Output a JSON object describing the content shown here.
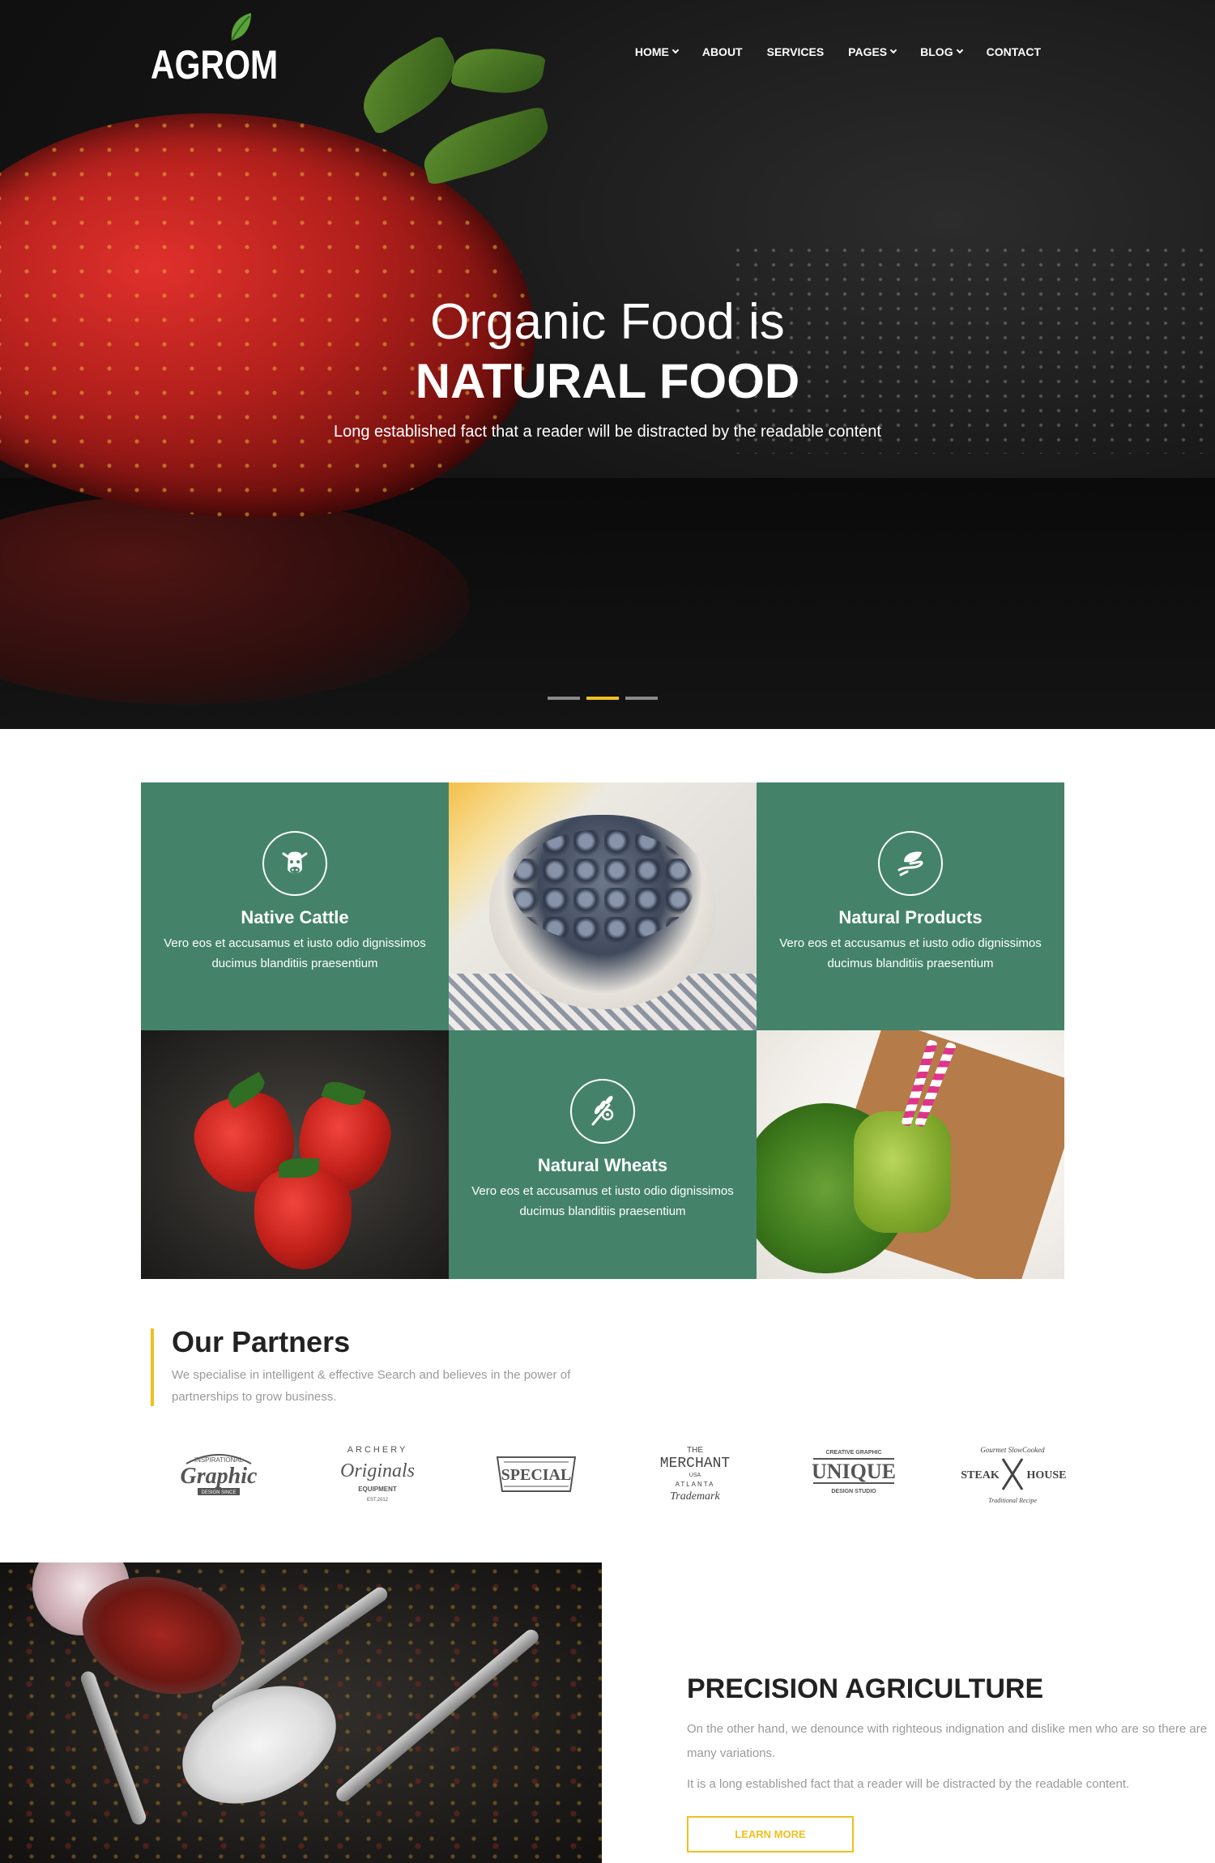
{
  "brand": {
    "logo_text": "AGROM",
    "accent": "#f0c020",
    "green": "#44836a"
  },
  "nav": {
    "items": [
      {
        "label": "HOME",
        "dropdown": true
      },
      {
        "label": "ABOUT",
        "dropdown": false
      },
      {
        "label": "SERVICES",
        "dropdown": false
      },
      {
        "label": "PAGES",
        "dropdown": true
      },
      {
        "label": "BLOG",
        "dropdown": true
      },
      {
        "label": "CONTACT",
        "dropdown": false
      }
    ]
  },
  "hero": {
    "title_line1": "Organic Food is",
    "title_line2": "NATURAL FOOD",
    "subtitle": "Long established fact that a reader will be distracted by the readable content",
    "slides": 3,
    "active_slide": 2
  },
  "features": [
    {
      "icon": "cow-icon",
      "title": "Native Cattle",
      "text": "Vero eos et accusamus et iusto odio dignissimos ducimus blanditiis praesentium"
    },
    {
      "icon": "leaf-hand-icon",
      "title": "Natural Products",
      "text": "Vero eos et accusamus et iusto odio dignissimos ducimus blanditiis praesentium"
    },
    {
      "icon": "wheat-icon",
      "title": "Natural Wheats",
      "text": "Vero eos et accusamus et iusto odio dignissimos ducimus blanditiis praesentium"
    }
  ],
  "partners": {
    "title_light": "Our",
    "title_bold": "Partners",
    "text": "We specialise in intelligent & effective Search and believes in the power of partnerships to grow business.",
    "logos": [
      {
        "name": "graphic-logo",
        "line1": "INSPIRATIONAL",
        "line2": "Graphic",
        "line3": "DESIGN SINCE"
      },
      {
        "name": "archery-logo",
        "line1": "ARCHERY",
        "line2": "Originals",
        "line3": "EQUIPMENT",
        "line4": "EST.2012"
      },
      {
        "name": "special-logo",
        "line1": "SPECIAL"
      },
      {
        "name": "merchant-logo",
        "line1": "THE",
        "line2": "MERCHANT",
        "line3": "USA",
        "line4": "ATLANTA",
        "line5": "Trademark"
      },
      {
        "name": "unique-logo",
        "line1": "CREATIVE GRAPHIC",
        "line2": "UNIQUE",
        "line3": "DESIGN STUDIO"
      },
      {
        "name": "steakhouse-logo",
        "line1": "Gourmet SlowCooked",
        "line2": "STEAK",
        "line3": "HOUSE",
        "line4": "Traditional Recipe"
      }
    ]
  },
  "precision": {
    "title_light": "PRECISION",
    "title_bold": "AGRICULTURE",
    "p1": "On the other hand, we denounce with righteous indignation and dislike men who are so there are many variations.",
    "p2": "It is a long established fact that a reader will be distracted by the readable content.",
    "button": "LEARN MORE"
  }
}
